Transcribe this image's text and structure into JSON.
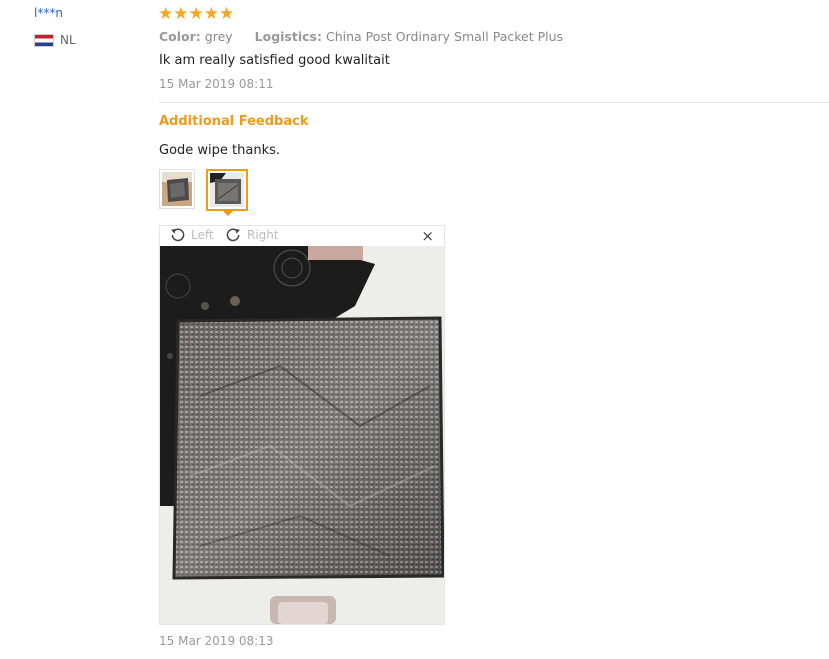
{
  "reviewer": {
    "name": "l***n",
    "country": "NL",
    "flag_colors": [
      "#c0222c",
      "#ffffff",
      "#2b3f8c"
    ]
  },
  "review": {
    "stars": 5,
    "star_glyph": "★",
    "star_color": "#f5a623",
    "color_label": "Color:",
    "color_value": "grey",
    "logistics_label": "Logistics:",
    "logistics_value": "China Post Ordinary Small Packet Plus",
    "text": "Ik am really satisfied good kwalitait",
    "date": "15 Mar 2019 08:11"
  },
  "additional_feedback": {
    "title": "Additional Feedback",
    "title_color": "#f29a14",
    "text": "Gode wipe thanks.",
    "thumbnails": [
      "cloth-on-box-photo",
      "grey-cloth-photo"
    ],
    "selected_thumbnail": 2,
    "date": "15 Mar 2019 08:13"
  },
  "viewer": {
    "rotate_left_label": "Left",
    "rotate_right_label": "Right",
    "close_glyph": "×"
  }
}
